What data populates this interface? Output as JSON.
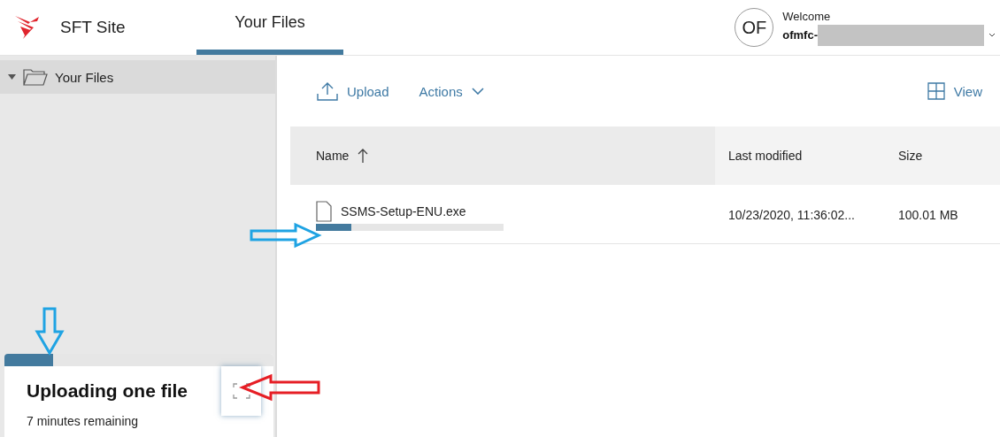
{
  "header": {
    "site_name": "SFT Site",
    "tabs": [
      {
        "label": "Your Files",
        "selected": true
      }
    ],
    "user": {
      "initials": "OF",
      "greeting": "Welcome",
      "name": "ofmfc-"
    }
  },
  "sidebar": {
    "tree": [
      {
        "label": "Your Files",
        "expanded": true,
        "selected": true
      }
    ]
  },
  "toolbar": {
    "actions": [
      {
        "kind": "upload",
        "label": "Upload"
      },
      {
        "kind": "menu",
        "label": "Actions"
      }
    ],
    "view": "View"
  },
  "table": {
    "columns": [
      {
        "label": "Name",
        "sorted": true
      },
      {
        "label": "Last modified",
        "sorted": false
      },
      {
        "label": "Size",
        "sorted": false
      }
    ],
    "rows": [
      {
        "name": "SSMS-Setup-ENU.exe",
        "modified": "10/23/2020, 11:36:02...",
        "size": "100.01 MB",
        "level": 0.19
      }
    ]
  },
  "upload_panel": {
    "title": "Uploading one file",
    "status": "7 minutes remaining",
    "level": 0.18
  }
}
